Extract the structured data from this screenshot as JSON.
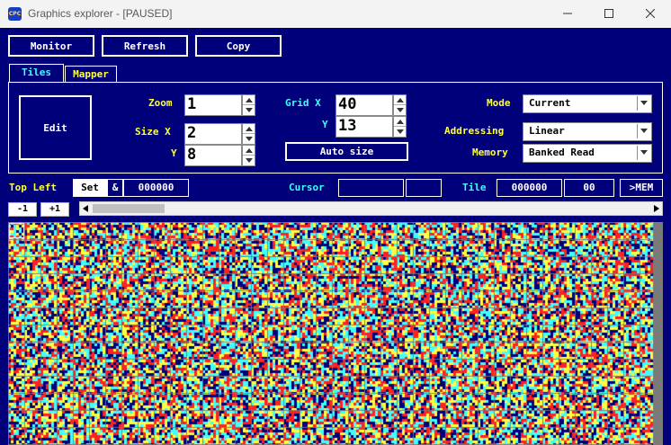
{
  "window": {
    "title": "Graphics explorer - [PAUSED]",
    "app_icon_text": "CPC"
  },
  "toolbar": {
    "monitor": "Monitor",
    "refresh": "Refresh",
    "copy": "Copy"
  },
  "tabs": [
    {
      "label": "Tiles",
      "active": true
    },
    {
      "label": "Mapper",
      "active": false
    }
  ],
  "tiles": {
    "edit_label": "Edit",
    "zoom_label": "Zoom",
    "zoom_value": "1",
    "size_x_label": "Size X",
    "size_x_value": "2",
    "size_y_label": "Y",
    "size_y_value": "8",
    "grid_x_label": "Grid X",
    "grid_x_value": "40",
    "grid_y_label": "Y",
    "grid_y_value": "13",
    "auto_size_label": "Auto size",
    "mode_label": "Mode",
    "mode_value": "Current",
    "addressing_label": "Addressing",
    "addressing_value": "Linear",
    "memory_label": "Memory",
    "memory_value": "Banked Read"
  },
  "status_row": {
    "top_left_label": "Top Left",
    "set_label": "Set",
    "amp_label": "&",
    "top_left_value": "000000",
    "cursor_label": "Cursor",
    "cursor_value_1": "",
    "cursor_value_2": "",
    "tile_label": "Tile",
    "tile_address": "000000",
    "tile_index": "00",
    "mem_button": ">MEM"
  },
  "nav": {
    "minus_one": "-1",
    "plus_one": "+1"
  },
  "colors": {
    "background": "#00007a",
    "label_yellow": "#ffff40",
    "label_cyan": "#40ffff",
    "palette": [
      "#00007a",
      "#ffff40",
      "#40ffff",
      "#ff2020"
    ]
  }
}
